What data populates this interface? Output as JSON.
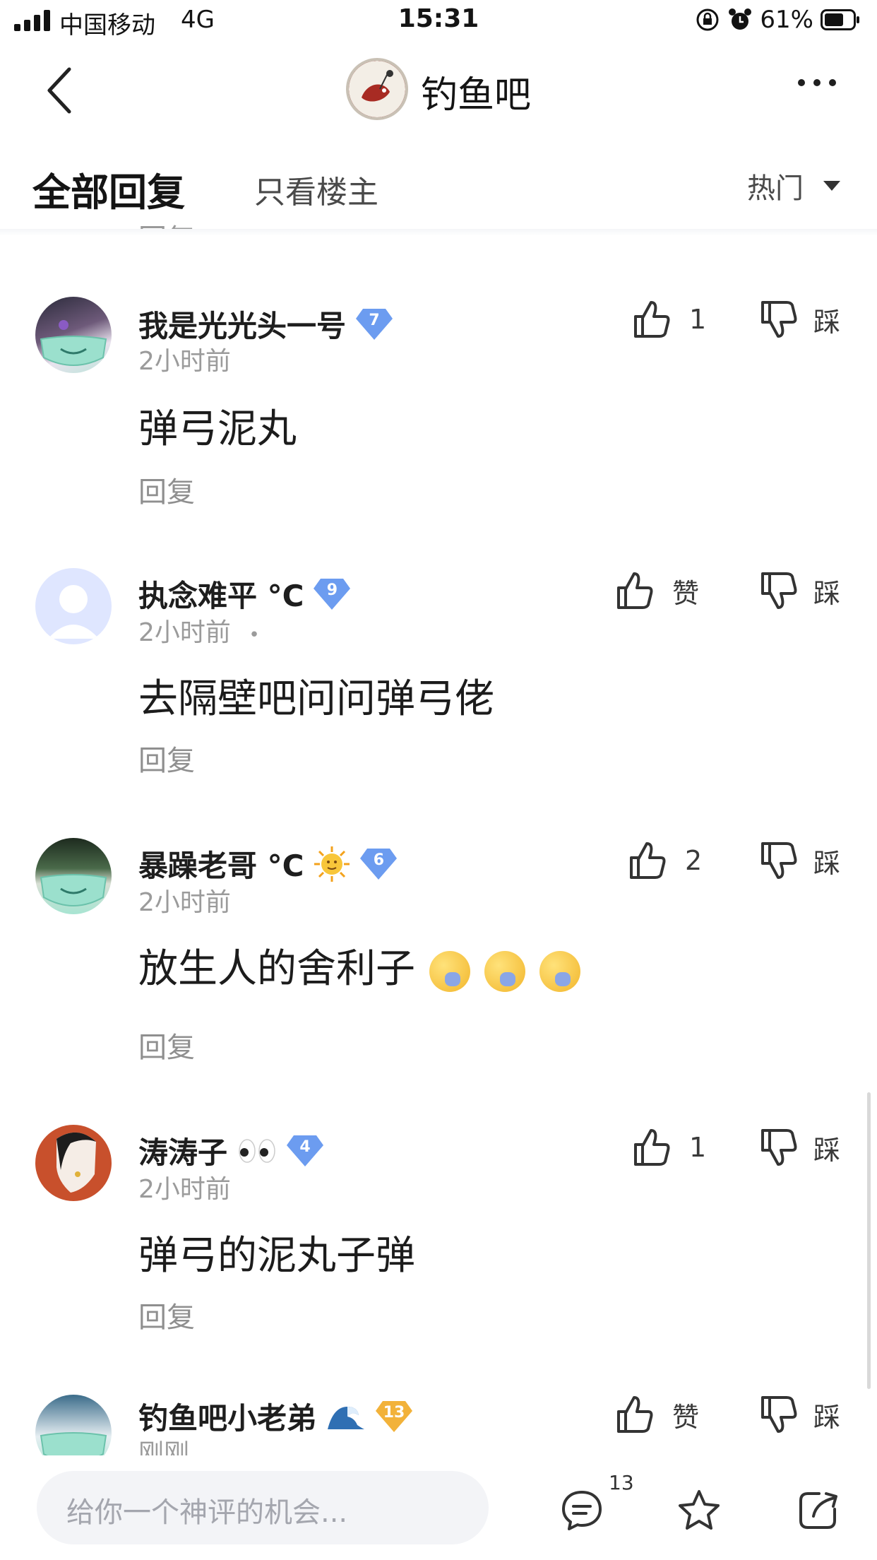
{
  "status_bar": {
    "carrier": "中国移动",
    "network": "4G",
    "time": "15:31",
    "battery": "61%"
  },
  "nav": {
    "forum_name": "钓鱼吧"
  },
  "tabs": {
    "all_replies": "全部回复",
    "only_op": "只看楼主",
    "sort": "热门"
  },
  "comments": [
    {
      "username": "我是光光头一号",
      "level": "7",
      "time": "2小时前",
      "content": "弹弓泥丸",
      "reply": "回复",
      "likes": "1",
      "dislike": "踩"
    },
    {
      "username": "执念难平 °C",
      "level": "9",
      "time": "2小时前",
      "dot": "•",
      "content": "去隔壁吧问问弹弓佬",
      "reply": "回复",
      "likes": "赞",
      "dislike": "踩"
    },
    {
      "username": "暴躁老哥 °C",
      "level": "6",
      "time": "2小时前",
      "content": "放生人的舍利子",
      "reply": "回复",
      "likes": "2",
      "dislike": "踩"
    },
    {
      "username": "涛涛子",
      "level": "4",
      "time": "2小时前",
      "content": "弹弓的泥丸子弹",
      "reply": "回复",
      "likes": "1",
      "dislike": "踩"
    },
    {
      "username": "钓鱼吧小老弟",
      "level": "13",
      "time": "刚刚",
      "likes": "赞",
      "dislike": "踩"
    }
  ],
  "peek_text": "回复",
  "bottom_bar": {
    "input_placeholder": "给你一个神评的机会...",
    "comment_count": "13"
  },
  "colors": {
    "level_blue": "#6c9cf0",
    "level_gold": "#f2b23a",
    "avatar_blank": "#dfe6ff"
  }
}
